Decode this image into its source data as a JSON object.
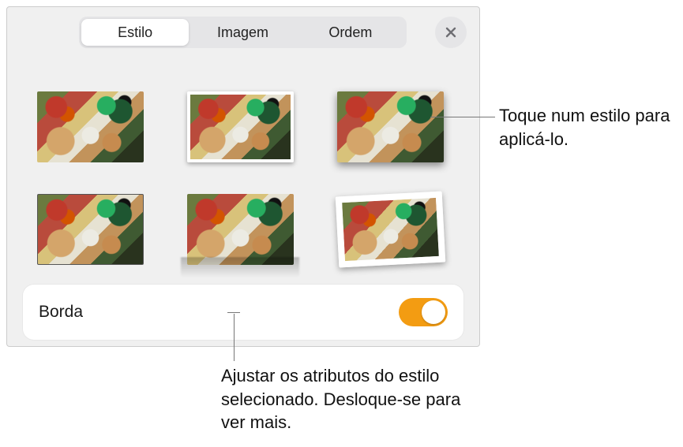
{
  "tabs": {
    "style": "Estilo",
    "image": "Imagem",
    "order": "Ordem",
    "active": "style"
  },
  "styles_grid": {
    "count": 6
  },
  "options": {
    "border_label": "Borda",
    "border_on": true
  },
  "callouts": {
    "tap_style": "Toque num estilo para aplicá-lo.",
    "adjust_attrs": "Ajustar os atributos do estilo selecionado. Desloque-se para ver mais."
  }
}
